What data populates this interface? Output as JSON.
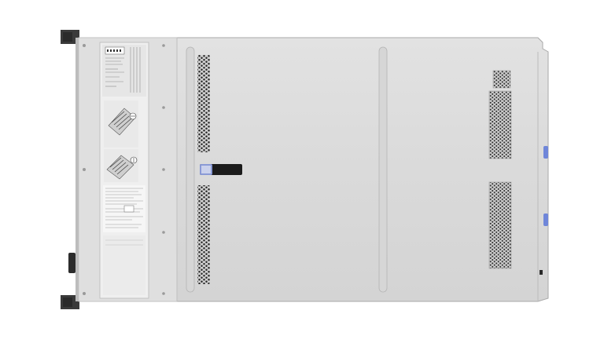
{
  "product": {
    "view": "server-chassis-top-view",
    "colors": {
      "chassis": "#dcdcdc",
      "chassis_edge": "#9a9a9a",
      "rack_ear": "#3a3a3a",
      "vent_hole": "#2b2b2b",
      "latch": "#1a1a1a",
      "latch_accent": "#7a8fd6",
      "connector_blue": "#6f86d9"
    }
  },
  "service_label": {
    "icon_names": [
      "memory-diagram-icon",
      "fan-diagram-icon",
      "compliance-mark-icon"
    ]
  }
}
